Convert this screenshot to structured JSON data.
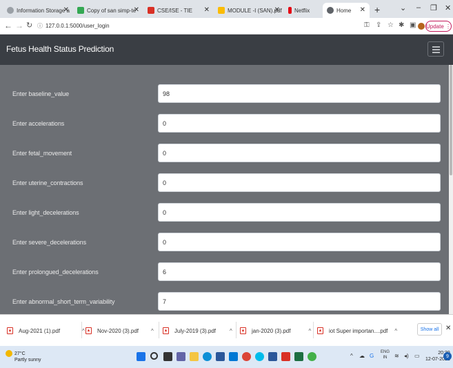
{
  "browser": {
    "tabs": [
      {
        "title": "Information Storage a",
        "icon": "globe-icon",
        "color": "#5f6368"
      },
      {
        "title": "Copy of san simp-te",
        "icon": "google-drive-icon",
        "color": "#34a853"
      },
      {
        "title": "CSE/ISE - TIE",
        "icon": "bookmark-icon",
        "color": "#d93025"
      },
      {
        "title": "MODULE -I (SAN).pdf",
        "icon": "google-drive-icon",
        "color": "#fbbc04"
      },
      {
        "title": "Netflix",
        "icon": "netflix-icon",
        "color": "#e50914"
      },
      {
        "title": "Home",
        "icon": "globe-icon",
        "color": "#5f6368",
        "active": true
      }
    ],
    "url": "127.0.0.1:5000/user_login",
    "update_label": "Update"
  },
  "app": {
    "brand": "Fetus Health Status Prediction"
  },
  "form": {
    "fields": [
      {
        "label": "Enter baseline_value",
        "value": "98"
      },
      {
        "label": "Enter accelerations",
        "value": "0"
      },
      {
        "label": "Enter fetal_movement",
        "value": "0"
      },
      {
        "label": "Enter uterine_contractions",
        "value": "0"
      },
      {
        "label": "Enter light_decelerations",
        "value": "0"
      },
      {
        "label": "Enter severe_decelerations",
        "value": "0"
      },
      {
        "label": "Enter prolongued_decelerations",
        "value": "6"
      },
      {
        "label": "Enter abnormal_short_term_variability",
        "value": "7"
      }
    ]
  },
  "downloads": {
    "items": [
      "Aug-2021 (1).pdf",
      "Nov-2020 (3).pdf",
      "July-2019 (3).pdf",
      "jan-2020 (3).pdf",
      "iot Super importan....pdf"
    ],
    "show_all": "Show all"
  },
  "taskbar": {
    "weather_temp": "27°C",
    "weather_desc": "Partly sunny",
    "lang_top": "ENG",
    "lang_bottom": "IN",
    "time": "20:39",
    "date": "12-07-2022",
    "notification_count": "9",
    "pinned_icons": [
      "windows-icon",
      "search-icon",
      "task-view-icon",
      "chat-icon",
      "file-explorer-icon",
      "edge-icon",
      "store-icon",
      "mail-icon",
      "chrome-icon",
      "webex-icon",
      "word-icon",
      "acrobat-icon",
      "excel-icon",
      "anaconda-icon"
    ]
  }
}
